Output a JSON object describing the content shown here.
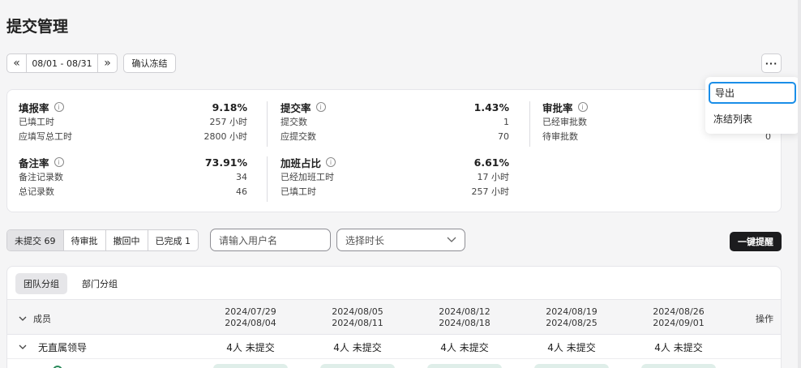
{
  "page_title": "提交管理",
  "toolbar": {
    "prev_icon": "«",
    "range": "08/01 - 08/31",
    "next_icon": "»",
    "confirm_freeze": "确认冻结",
    "more_icon": "···"
  },
  "more_menu": [
    "导出",
    "冻结列表"
  ],
  "stats": {
    "fill": {
      "label": "填报率",
      "value": "9.18%",
      "rows": [
        [
          "已填工时",
          "257 小时"
        ],
        [
          "应填写总工时",
          "2800 小时"
        ]
      ]
    },
    "submit": {
      "label": "提交率",
      "value": "1.43%",
      "rows": [
        [
          "提交数",
          "1"
        ],
        [
          "应提交数",
          "70"
        ]
      ]
    },
    "approve": {
      "label": "审批率",
      "rows": [
        [
          "已经审批数",
          ""
        ],
        [
          "待审批数",
          "0"
        ]
      ]
    },
    "note": {
      "label": "备注率",
      "value": "73.91%",
      "rows": [
        [
          "备注记录数",
          "34"
        ],
        [
          "总记录数",
          "46"
        ]
      ]
    },
    "overtime": {
      "label": "加班占比",
      "value": "6.61%",
      "rows": [
        [
          "已经加班工时",
          "17 小时"
        ],
        [
          "已填工时",
          "257 小时"
        ]
      ]
    }
  },
  "filter_tabs": [
    "未提交 69",
    "待审批",
    "撤回中",
    "已完成 1"
  ],
  "user_input": {
    "placeholder": "请输入用户名"
  },
  "duration_select": {
    "placeholder": "选择时长"
  },
  "remind_button": "一键提醒",
  "group_tabs": [
    "团队分组",
    "部门分组"
  ],
  "table": {
    "member_header": "成员",
    "action_header": "操作",
    "weeks": [
      [
        "2024/07/29",
        "2024/08/04"
      ],
      [
        "2024/08/05",
        "2024/08/11"
      ],
      [
        "2024/08/12",
        "2024/08/18"
      ],
      [
        "2024/08/19",
        "2024/08/25"
      ],
      [
        "2024/08/26",
        "2024/09/01"
      ]
    ],
    "rows": [
      {
        "name": "无直属领导",
        "cells": [
          "4人 未提交",
          "4人 未提交",
          "4人 未提交",
          "4人 未提交",
          "4人 未提交"
        ]
      }
    ]
  },
  "colors": {
    "accent_focus": "#1a8ee8",
    "primary_button": "#1c1c1e",
    "status_pill": "#dfeee9"
  }
}
